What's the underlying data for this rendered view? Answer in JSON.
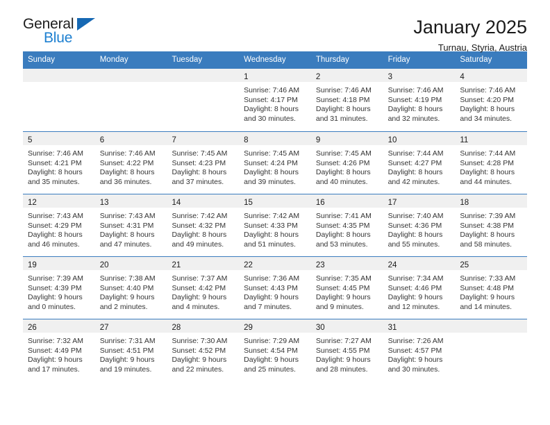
{
  "brand": {
    "name_top": "General",
    "name_bottom": "Blue",
    "triangle_icon": "brand-triangle-icon",
    "accent_color": "#1c7fd0"
  },
  "header": {
    "title": "January 2025",
    "subtitle": "Turnau, Styria, Austria"
  },
  "theme": {
    "header_bar_color": "#3a7cbe",
    "day_band_color": "#f0f0f0",
    "text_color": "#333333"
  },
  "weekdays": [
    "Sunday",
    "Monday",
    "Tuesday",
    "Wednesday",
    "Thursday",
    "Friday",
    "Saturday"
  ],
  "weeks": [
    [
      {
        "day": "",
        "empty": true,
        "lines": []
      },
      {
        "day": "",
        "empty": true,
        "lines": []
      },
      {
        "day": "",
        "empty": true,
        "lines": []
      },
      {
        "day": "1",
        "empty": false,
        "lines": [
          "Sunrise: 7:46 AM",
          "Sunset: 4:17 PM",
          "Daylight: 8 hours",
          "and 30 minutes."
        ]
      },
      {
        "day": "2",
        "empty": false,
        "lines": [
          "Sunrise: 7:46 AM",
          "Sunset: 4:18 PM",
          "Daylight: 8 hours",
          "and 31 minutes."
        ]
      },
      {
        "day": "3",
        "empty": false,
        "lines": [
          "Sunrise: 7:46 AM",
          "Sunset: 4:19 PM",
          "Daylight: 8 hours",
          "and 32 minutes."
        ]
      },
      {
        "day": "4",
        "empty": false,
        "lines": [
          "Sunrise: 7:46 AM",
          "Sunset: 4:20 PM",
          "Daylight: 8 hours",
          "and 34 minutes."
        ]
      }
    ],
    [
      {
        "day": "5",
        "empty": false,
        "lines": [
          "Sunrise: 7:46 AM",
          "Sunset: 4:21 PM",
          "Daylight: 8 hours",
          "and 35 minutes."
        ]
      },
      {
        "day": "6",
        "empty": false,
        "lines": [
          "Sunrise: 7:46 AM",
          "Sunset: 4:22 PM",
          "Daylight: 8 hours",
          "and 36 minutes."
        ]
      },
      {
        "day": "7",
        "empty": false,
        "lines": [
          "Sunrise: 7:45 AM",
          "Sunset: 4:23 PM",
          "Daylight: 8 hours",
          "and 37 minutes."
        ]
      },
      {
        "day": "8",
        "empty": false,
        "lines": [
          "Sunrise: 7:45 AM",
          "Sunset: 4:24 PM",
          "Daylight: 8 hours",
          "and 39 minutes."
        ]
      },
      {
        "day": "9",
        "empty": false,
        "lines": [
          "Sunrise: 7:45 AM",
          "Sunset: 4:26 PM",
          "Daylight: 8 hours",
          "and 40 minutes."
        ]
      },
      {
        "day": "10",
        "empty": false,
        "lines": [
          "Sunrise: 7:44 AM",
          "Sunset: 4:27 PM",
          "Daylight: 8 hours",
          "and 42 minutes."
        ]
      },
      {
        "day": "11",
        "empty": false,
        "lines": [
          "Sunrise: 7:44 AM",
          "Sunset: 4:28 PM",
          "Daylight: 8 hours",
          "and 44 minutes."
        ]
      }
    ],
    [
      {
        "day": "12",
        "empty": false,
        "lines": [
          "Sunrise: 7:43 AM",
          "Sunset: 4:29 PM",
          "Daylight: 8 hours",
          "and 46 minutes."
        ]
      },
      {
        "day": "13",
        "empty": false,
        "lines": [
          "Sunrise: 7:43 AM",
          "Sunset: 4:31 PM",
          "Daylight: 8 hours",
          "and 47 minutes."
        ]
      },
      {
        "day": "14",
        "empty": false,
        "lines": [
          "Sunrise: 7:42 AM",
          "Sunset: 4:32 PM",
          "Daylight: 8 hours",
          "and 49 minutes."
        ]
      },
      {
        "day": "15",
        "empty": false,
        "lines": [
          "Sunrise: 7:42 AM",
          "Sunset: 4:33 PM",
          "Daylight: 8 hours",
          "and 51 minutes."
        ]
      },
      {
        "day": "16",
        "empty": false,
        "lines": [
          "Sunrise: 7:41 AM",
          "Sunset: 4:35 PM",
          "Daylight: 8 hours",
          "and 53 minutes."
        ]
      },
      {
        "day": "17",
        "empty": false,
        "lines": [
          "Sunrise: 7:40 AM",
          "Sunset: 4:36 PM",
          "Daylight: 8 hours",
          "and 55 minutes."
        ]
      },
      {
        "day": "18",
        "empty": false,
        "lines": [
          "Sunrise: 7:39 AM",
          "Sunset: 4:38 PM",
          "Daylight: 8 hours",
          "and 58 minutes."
        ]
      }
    ],
    [
      {
        "day": "19",
        "empty": false,
        "lines": [
          "Sunrise: 7:39 AM",
          "Sunset: 4:39 PM",
          "Daylight: 9 hours",
          "and 0 minutes."
        ]
      },
      {
        "day": "20",
        "empty": false,
        "lines": [
          "Sunrise: 7:38 AM",
          "Sunset: 4:40 PM",
          "Daylight: 9 hours",
          "and 2 minutes."
        ]
      },
      {
        "day": "21",
        "empty": false,
        "lines": [
          "Sunrise: 7:37 AM",
          "Sunset: 4:42 PM",
          "Daylight: 9 hours",
          "and 4 minutes."
        ]
      },
      {
        "day": "22",
        "empty": false,
        "lines": [
          "Sunrise: 7:36 AM",
          "Sunset: 4:43 PM",
          "Daylight: 9 hours",
          "and 7 minutes."
        ]
      },
      {
        "day": "23",
        "empty": false,
        "lines": [
          "Sunrise: 7:35 AM",
          "Sunset: 4:45 PM",
          "Daylight: 9 hours",
          "and 9 minutes."
        ]
      },
      {
        "day": "24",
        "empty": false,
        "lines": [
          "Sunrise: 7:34 AM",
          "Sunset: 4:46 PM",
          "Daylight: 9 hours",
          "and 12 minutes."
        ]
      },
      {
        "day": "25",
        "empty": false,
        "lines": [
          "Sunrise: 7:33 AM",
          "Sunset: 4:48 PM",
          "Daylight: 9 hours",
          "and 14 minutes."
        ]
      }
    ],
    [
      {
        "day": "26",
        "empty": false,
        "lines": [
          "Sunrise: 7:32 AM",
          "Sunset: 4:49 PM",
          "Daylight: 9 hours",
          "and 17 minutes."
        ]
      },
      {
        "day": "27",
        "empty": false,
        "lines": [
          "Sunrise: 7:31 AM",
          "Sunset: 4:51 PM",
          "Daylight: 9 hours",
          "and 19 minutes."
        ]
      },
      {
        "day": "28",
        "empty": false,
        "lines": [
          "Sunrise: 7:30 AM",
          "Sunset: 4:52 PM",
          "Daylight: 9 hours",
          "and 22 minutes."
        ]
      },
      {
        "day": "29",
        "empty": false,
        "lines": [
          "Sunrise: 7:29 AM",
          "Sunset: 4:54 PM",
          "Daylight: 9 hours",
          "and 25 minutes."
        ]
      },
      {
        "day": "30",
        "empty": false,
        "lines": [
          "Sunrise: 7:27 AM",
          "Sunset: 4:55 PM",
          "Daylight: 9 hours",
          "and 28 minutes."
        ]
      },
      {
        "day": "31",
        "empty": false,
        "lines": [
          "Sunrise: 7:26 AM",
          "Sunset: 4:57 PM",
          "Daylight: 9 hours",
          "and 30 minutes."
        ]
      },
      {
        "day": "",
        "empty": true,
        "lines": []
      }
    ]
  ]
}
